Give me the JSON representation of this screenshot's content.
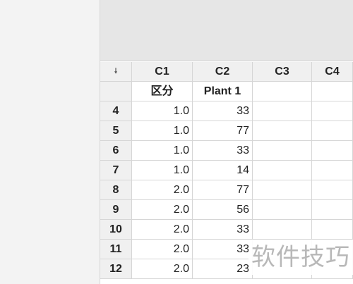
{
  "worksheet": {
    "corner_icon": "down-arrow-icon",
    "column_ids": [
      "C1",
      "C2",
      "C3",
      "C4"
    ],
    "column_names": [
      "区分",
      "Plant 1",
      "",
      ""
    ],
    "rows": [
      {
        "num": "4",
        "c1": "1.0",
        "c2": "33"
      },
      {
        "num": "5",
        "c1": "1.0",
        "c2": "77"
      },
      {
        "num": "6",
        "c1": "1.0",
        "c2": "33"
      },
      {
        "num": "7",
        "c1": "1.0",
        "c2": "14"
      },
      {
        "num": "8",
        "c1": "2.0",
        "c2": "77"
      },
      {
        "num": "9",
        "c1": "2.0",
        "c2": "56"
      },
      {
        "num": "10",
        "c1": "2.0",
        "c2": "33"
      },
      {
        "num": "11",
        "c1": "2.0",
        "c2": "33"
      },
      {
        "num": "12",
        "c1": "2.0",
        "c2": "23"
      }
    ]
  },
  "watermark": "软件技巧"
}
